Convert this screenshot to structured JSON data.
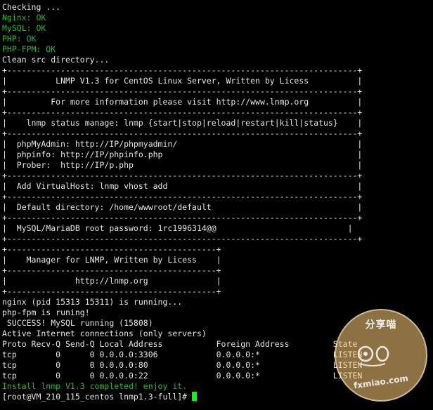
{
  "terminal": {
    "lines": [
      {
        "text": "Checking ...",
        "color": "default"
      },
      {
        "text": "Nginx: OK",
        "color": "green"
      },
      {
        "text": "MySQL: OK",
        "color": "green"
      },
      {
        "text": "PHP: OK",
        "color": "green"
      },
      {
        "text": "PHP-FPM: OK",
        "color": "green"
      },
      {
        "text": "Clean src directory...",
        "color": "default"
      },
      {
        "text": "+------------------------------------------------------------------------+",
        "color": "default"
      },
      {
        "text": "|          LNMP V1.3 for CentOS Linux Server, Written by Licess          |",
        "color": "default"
      },
      {
        "text": "+------------------------------------------------------------------------+",
        "color": "default"
      },
      {
        "text": "|         For more information please visit http://www.lnmp.org          |",
        "color": "default"
      },
      {
        "text": "+------------------------------------------------------------------------+",
        "color": "default"
      },
      {
        "text": "|    lnmp status manage: lnmp {start|stop|reload|restart|kill|status}    |",
        "color": "default"
      },
      {
        "text": "+------------------------------------------------------------------------+",
        "color": "default"
      },
      {
        "text": "|  phpMyAdmin: http://IP/phpmyadmin/                                     |",
        "color": "default"
      },
      {
        "text": "|  phpinfo: http://IP/phpinfo.php                                        |",
        "color": "default"
      },
      {
        "text": "|  Prober:  http://IP/p.php                                              |",
        "color": "default"
      },
      {
        "text": "+------------------------------------------------------------------------+",
        "color": "default"
      },
      {
        "text": "|  Add VirtualHost: lnmp vhost add                                       |",
        "color": "default"
      },
      {
        "text": "+------------------------------------------------------------------------+",
        "color": "default"
      },
      {
        "text": "|  Default directory: /home/wwwroot/default                              |",
        "color": "default"
      },
      {
        "text": "+------------------------------------------------------------------------+",
        "color": "default"
      },
      {
        "text": "|  MySQL/MariaDB root password: 1rc1996314@@                           |",
        "color": "default"
      },
      {
        "text": "+------------------------------------------------------------------------+",
        "color": "default"
      },
      {
        "text": "+-------------------------------------------+",
        "color": "default"
      },
      {
        "text": "|    Manager for LNMP, Written by Licess    |",
        "color": "default"
      },
      {
        "text": "+-------------------------------------------+",
        "color": "default"
      },
      {
        "text": "|              http://lnmp.org              |",
        "color": "default"
      },
      {
        "text": "+-------------------------------------------+",
        "color": "default"
      },
      {
        "text": "nginx (pid 15313 15311) is running...",
        "color": "default"
      },
      {
        "text": "php-fpm is runing!",
        "color": "default"
      },
      {
        "text": " SUCCESS! MySQL running (15808)",
        "color": "default"
      },
      {
        "text": "Active Internet connections (only servers)",
        "color": "default"
      },
      {
        "text": "Proto Recv-Q Send-Q Local Address           Foreign Address         State",
        "color": "default"
      },
      {
        "text": "tcp        0      0 0.0.0.0:3306            0.0.0.0:*               LISTEN",
        "color": "default"
      },
      {
        "text": "tcp        0      0 0.0.0.0:80              0.0.0.0:*               LISTEN",
        "color": "default"
      },
      {
        "text": "tcp        0      0 0.0.0.0:22              0.0.0.0:*               LISTEN",
        "color": "default"
      },
      {
        "text": "Install lnmp V1.3 completed! enjoy it.",
        "color": "green"
      }
    ],
    "prompt": "[root@VM_210_115_centos lnmp1.3-full]# "
  },
  "watermark": {
    "top_text": "分享喵",
    "bottom_text": "fxmiao.com"
  },
  "colors": {
    "background": "#000000",
    "text": "#e6e6e6",
    "success": "#2fb82f",
    "cursor": "#00ff00"
  }
}
